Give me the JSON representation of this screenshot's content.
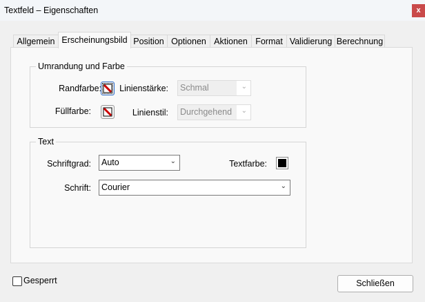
{
  "window": {
    "title": "Textfeld – Eigenschaften",
    "close_label": "x"
  },
  "tabs": [
    {
      "label": "Allgemein"
    },
    {
      "label": "Erscheinungsbild",
      "active": true
    },
    {
      "label": "Position"
    },
    {
      "label": "Optionen"
    },
    {
      "label": "Aktionen"
    },
    {
      "label": "Format"
    },
    {
      "label": "Validierung"
    },
    {
      "label": "Berechnung"
    }
  ],
  "border_group": {
    "legend": "Umrandung und Farbe",
    "border_color_label": "Randfarbe:",
    "fill_color_label": "Füllfarbe:",
    "line_width_label": "Linienstärke:",
    "line_width_value": "Schmal",
    "line_style_label": "Linienstil:",
    "line_style_value": "Durchgehend"
  },
  "text_group": {
    "legend": "Text",
    "font_size_label": "Schriftgrad:",
    "font_size_value": "Auto",
    "text_color_label": "Textfarbe:",
    "text_color": "#000000",
    "font_label": "Schrift:",
    "font_value": "Courier"
  },
  "footer": {
    "locked_label": "Gesperrt",
    "close_button": "Schließen"
  }
}
